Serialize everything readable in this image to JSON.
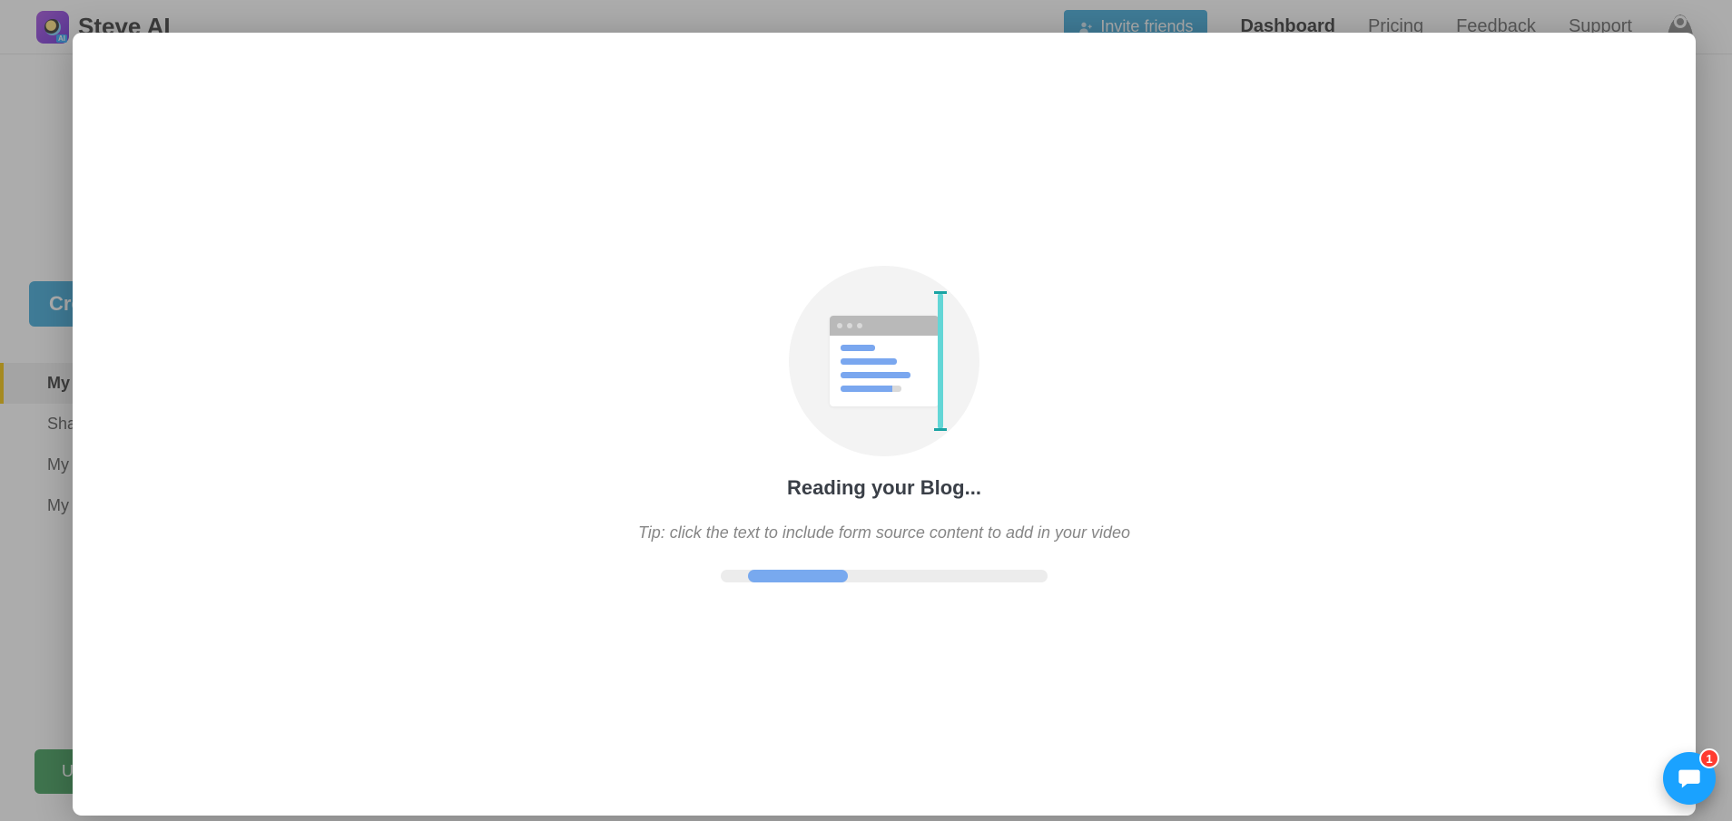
{
  "brand": {
    "name": "Steve AI"
  },
  "header": {
    "invite_label": "Invite friends",
    "nav": {
      "dashboard": "Dashboard",
      "pricing": "Pricing",
      "feedback": "Feedback",
      "support": "Support"
    }
  },
  "sidebar": {
    "create_label": "Create",
    "items": [
      "My Videos",
      "Shared",
      "My Workspace",
      "My Exports"
    ],
    "upgrade_label": "Upgrade"
  },
  "modal": {
    "title": "Reading your Blog...",
    "tip": "Tip: click the text to include form source content to add in your video"
  },
  "chat": {
    "badge": "1"
  }
}
